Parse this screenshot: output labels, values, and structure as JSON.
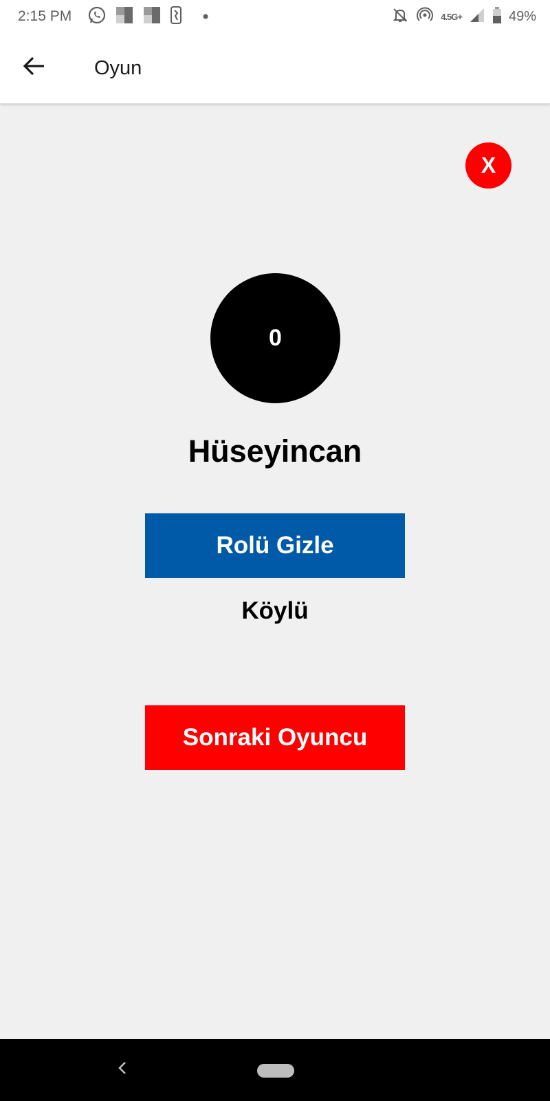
{
  "status_bar": {
    "time": "2:15 PM",
    "network_label": "4.5G+",
    "battery": "49%",
    "icons": [
      "whatsapp-icon",
      "notification-square-icon",
      "notification-square-icon",
      "nba-icon",
      "dot-icon",
      "mute-icon",
      "hotspot-icon",
      "signal-icon",
      "battery-icon"
    ]
  },
  "app_bar": {
    "title": "Oyun",
    "back_icon": "arrow-left-icon"
  },
  "game": {
    "close_label": "X",
    "counter": "0",
    "player_name": "Hüseyincan",
    "hide_role_label": "Rolü Gizle",
    "role": "Köylü",
    "next_player_label": "Sonraki Oyuncu"
  },
  "colors": {
    "blue_button": "#005aa8",
    "red": "#ff0000",
    "background": "#f0f0f0"
  },
  "nav_bar": {
    "icons": [
      "nav-back-icon",
      "nav-home-pill-icon"
    ]
  }
}
